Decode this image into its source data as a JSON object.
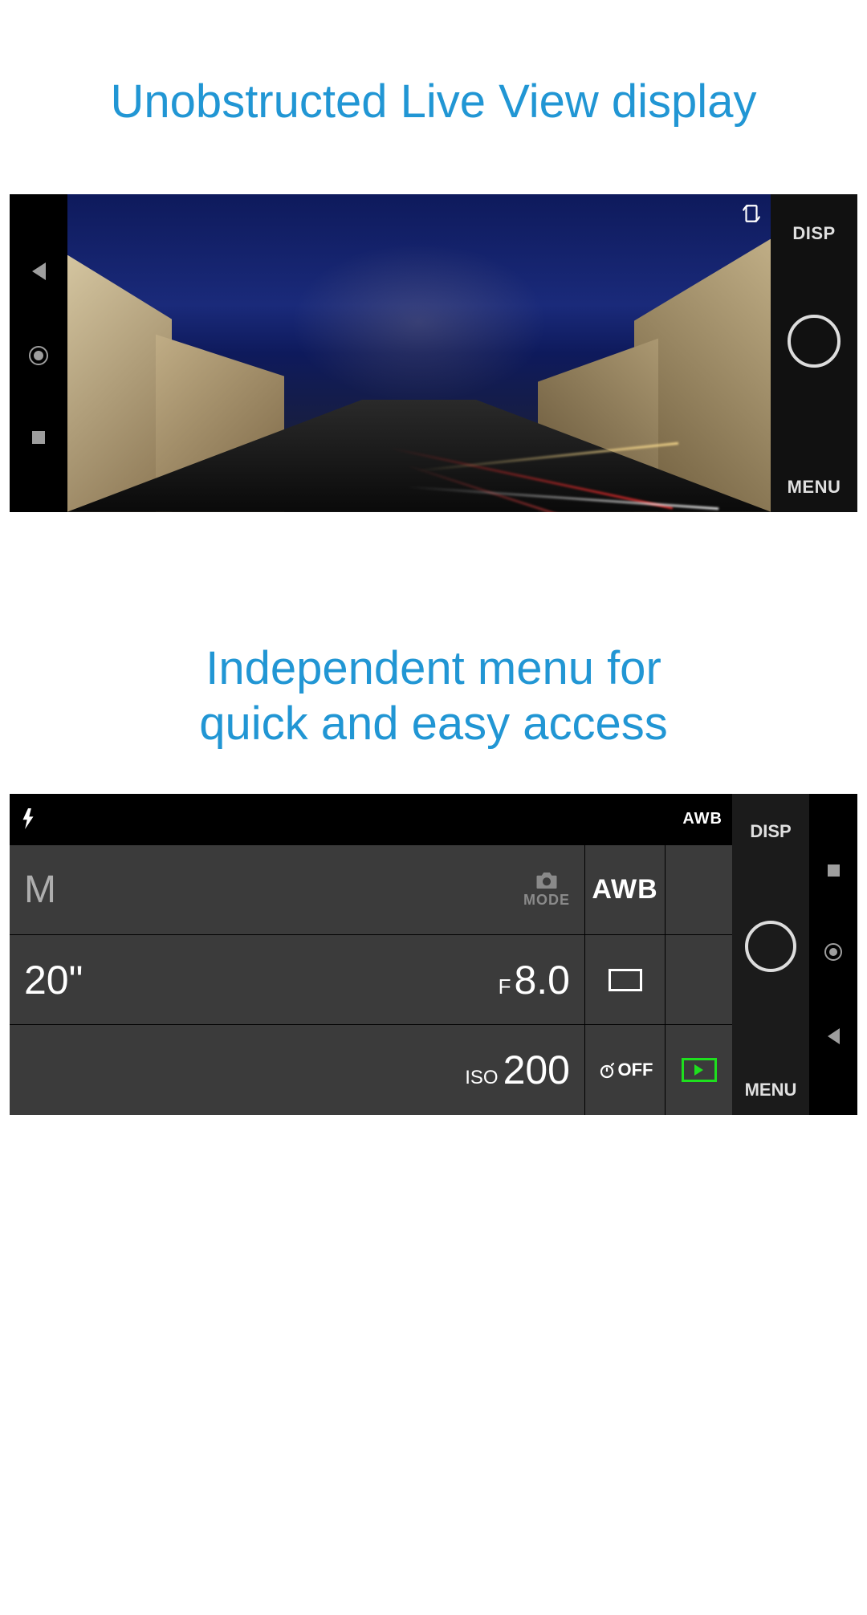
{
  "headings": {
    "liveview": "Unobstructed Live View display",
    "menu": "Independent menu for\nquick and easy access"
  },
  "shot1": {
    "disp": "DISP",
    "menu": "MENU",
    "rotate_icon": "rotate-screen-icon",
    "nav": {
      "back": "back",
      "home": "home",
      "recent": "recent"
    }
  },
  "shot2": {
    "disp": "DISP",
    "menu": "MENU",
    "flash_icon": "flash-icon",
    "awb_status": "AWB",
    "settings": {
      "mode": "M",
      "mode_label": "MODE",
      "awb": "AWB",
      "shutter": "20\"",
      "aperture_prefix": "F",
      "aperture": "8.0",
      "iso_label": "ISO",
      "iso": "200",
      "drive_icon": "single-shot-icon",
      "timer_off": "OFF",
      "playback_icon": "playback-icon"
    },
    "nav": {
      "recent": "recent",
      "home": "home",
      "back": "back"
    }
  }
}
